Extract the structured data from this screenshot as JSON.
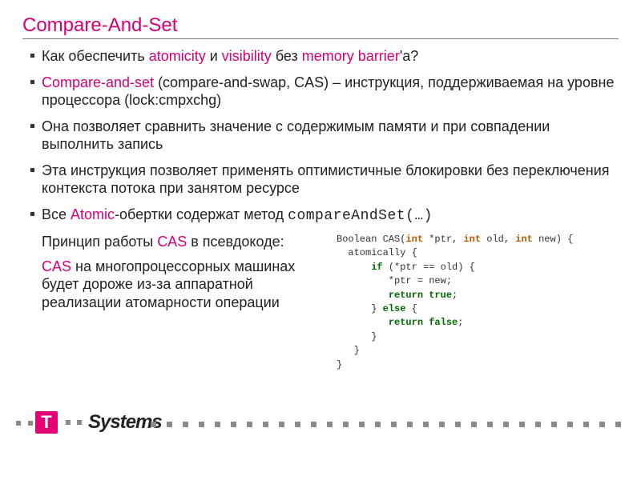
{
  "title": "Compare-And-Set",
  "bullets": {
    "b1": {
      "t1": "Как обеспечить ",
      "h1": "atomicity",
      "t2": " и ",
      "h2": "visibility",
      "t3": " без ",
      "h3": "memory barrier",
      "t4": "'a?"
    },
    "b2": {
      "h1": "Compare-and-set",
      "t1": " (compare-and-swap, CAS) – инструкция, поддерживаемая на уровне процессора (lock:cmpxchg)"
    },
    "b3": "Она позволяет сравнить значение с содержимым памяти и при совпадении выполнить запись",
    "b4": "Эта инструкция позволяет применять оптимистичные блокировки без переключения контекста потока при занятом ресурсе",
    "b5": {
      "t1": "Все ",
      "h1": "Atomic",
      "t2": "-обертки содержат метод ",
      "m1": "compareAndSet(…)"
    }
  },
  "left": {
    "p1": {
      "t1": "Принцип работы ",
      "h1": "CAS",
      "t2": " в псевдокоде:"
    },
    "p2": {
      "h1": "CAS",
      "t1": " на многопроцессорных машинах будет дороже из-за аппаратной реализации атомарности операции"
    }
  },
  "code": {
    "l1a": "Boolean CAS(",
    "l1b": "int",
    "l1c": " *ptr, ",
    "l1d": "int",
    "l1e": " old, ",
    "l1f": "int",
    "l1g": " new) {",
    "l2": "  atomically {",
    "l3a": "      ",
    "l3b": "if",
    "l3c": " (*ptr == old) {",
    "l4": "         *ptr = new;",
    "l5a": "         ",
    "l5b": "return true",
    "l5c": ";",
    "l6a": "      } ",
    "l6b": "else",
    "l6c": " {",
    "l7a": "         ",
    "l7b": "return false",
    "l7c": ";",
    "l8": "      }",
    "l9": "   }",
    "l10": "}"
  },
  "logo": {
    "t": "T",
    "brand": "Systems"
  }
}
